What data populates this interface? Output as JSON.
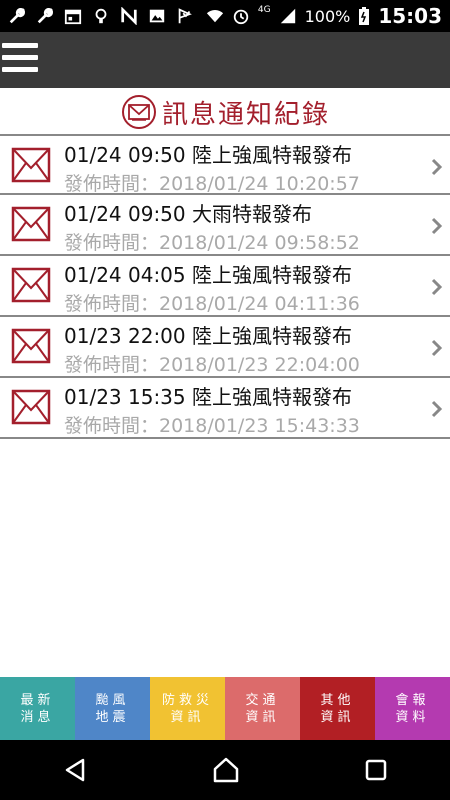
{
  "status_bar": {
    "network_label": "4G",
    "battery": "100%",
    "time": "15:03"
  },
  "page": {
    "title": "訊息通知紀錄"
  },
  "messages": [
    {
      "title": "01/24 09:50 陸上強風特報發布",
      "published": "發佈時間：2018/01/24 10:20:57"
    },
    {
      "title": "01/24 09:50 大雨特報發布",
      "published": "發佈時間：2018/01/24 09:58:52"
    },
    {
      "title": "01/24 04:05 陸上強風特報發布",
      "published": "發佈時間：2018/01/24 04:11:36"
    },
    {
      "title": "01/23 22:00 陸上強風特報發布",
      "published": "發佈時間：2018/01/23 22:04:00"
    },
    {
      "title": "01/23 15:35 陸上強風特報發布",
      "published": "發佈時間：2018/01/23 15:43:33"
    }
  ],
  "bottom_tabs": [
    {
      "line1": "最新",
      "line2": "消息",
      "color": "#3aa6a3"
    },
    {
      "line1": "颱風",
      "line2": "地震",
      "color": "#4f86c8"
    },
    {
      "line1": "防救災",
      "line2": "資訊",
      "color": "#f1c232"
    },
    {
      "line1": "交通",
      "line2": "資訊",
      "color": "#dc6b6b"
    },
    {
      "line1": "其他",
      "line2": "資訊",
      "color": "#b21f24"
    },
    {
      "line1": "會報",
      "line2": "資料",
      "color": "#b43ab0"
    }
  ],
  "colors": {
    "accent_red": "#a31f2c",
    "app_bar": "#3a3a3a"
  },
  "icons": [
    "wrench-icon",
    "calendar-icon",
    "lightbulb-icon",
    "nfc-icon",
    "image-icon",
    "flag-icon",
    "wifi-icon",
    "alarm-icon",
    "signal-icon",
    "battery-icon",
    "menu-icon",
    "envelope-icon",
    "chevron-right-icon",
    "back-icon",
    "home-icon",
    "recents-icon"
  ]
}
